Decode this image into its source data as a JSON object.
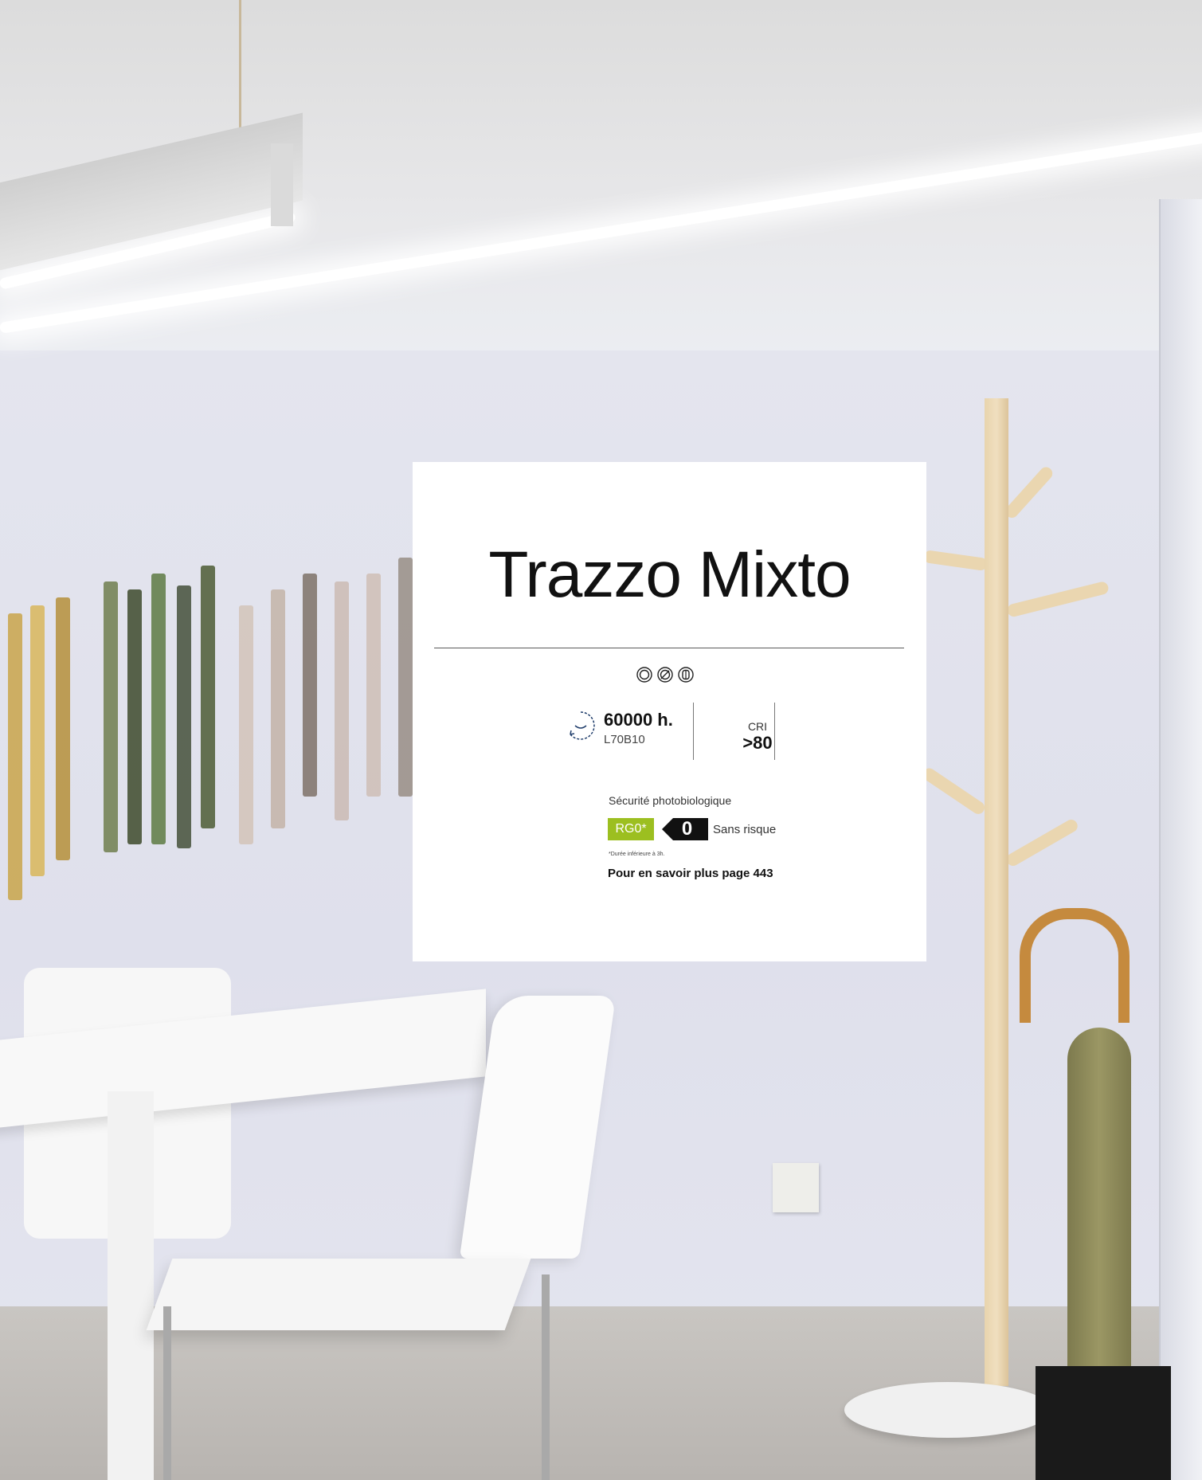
{
  "product": {
    "title": "Trazzo Mixto",
    "icons": [
      "dimmable-icon",
      "no-dim-icon",
      "driver-icon"
    ],
    "lifetime": {
      "hours": "60000 h.",
      "rating": "L70B10"
    },
    "cri": {
      "label": "CRI",
      "value": ">80"
    },
    "photobiological": {
      "title": "Sécurité photobiologique",
      "group": "RG0*",
      "risk_number": "0",
      "risk_label": "Sans risque",
      "footnote": "*Durée inférieure à 3h."
    },
    "more_info": "Pour en savoir plus page 443"
  },
  "colors": {
    "accent_green": "#9cbf20",
    "risk_black": "#111111",
    "card_bg": "#ffffff"
  }
}
